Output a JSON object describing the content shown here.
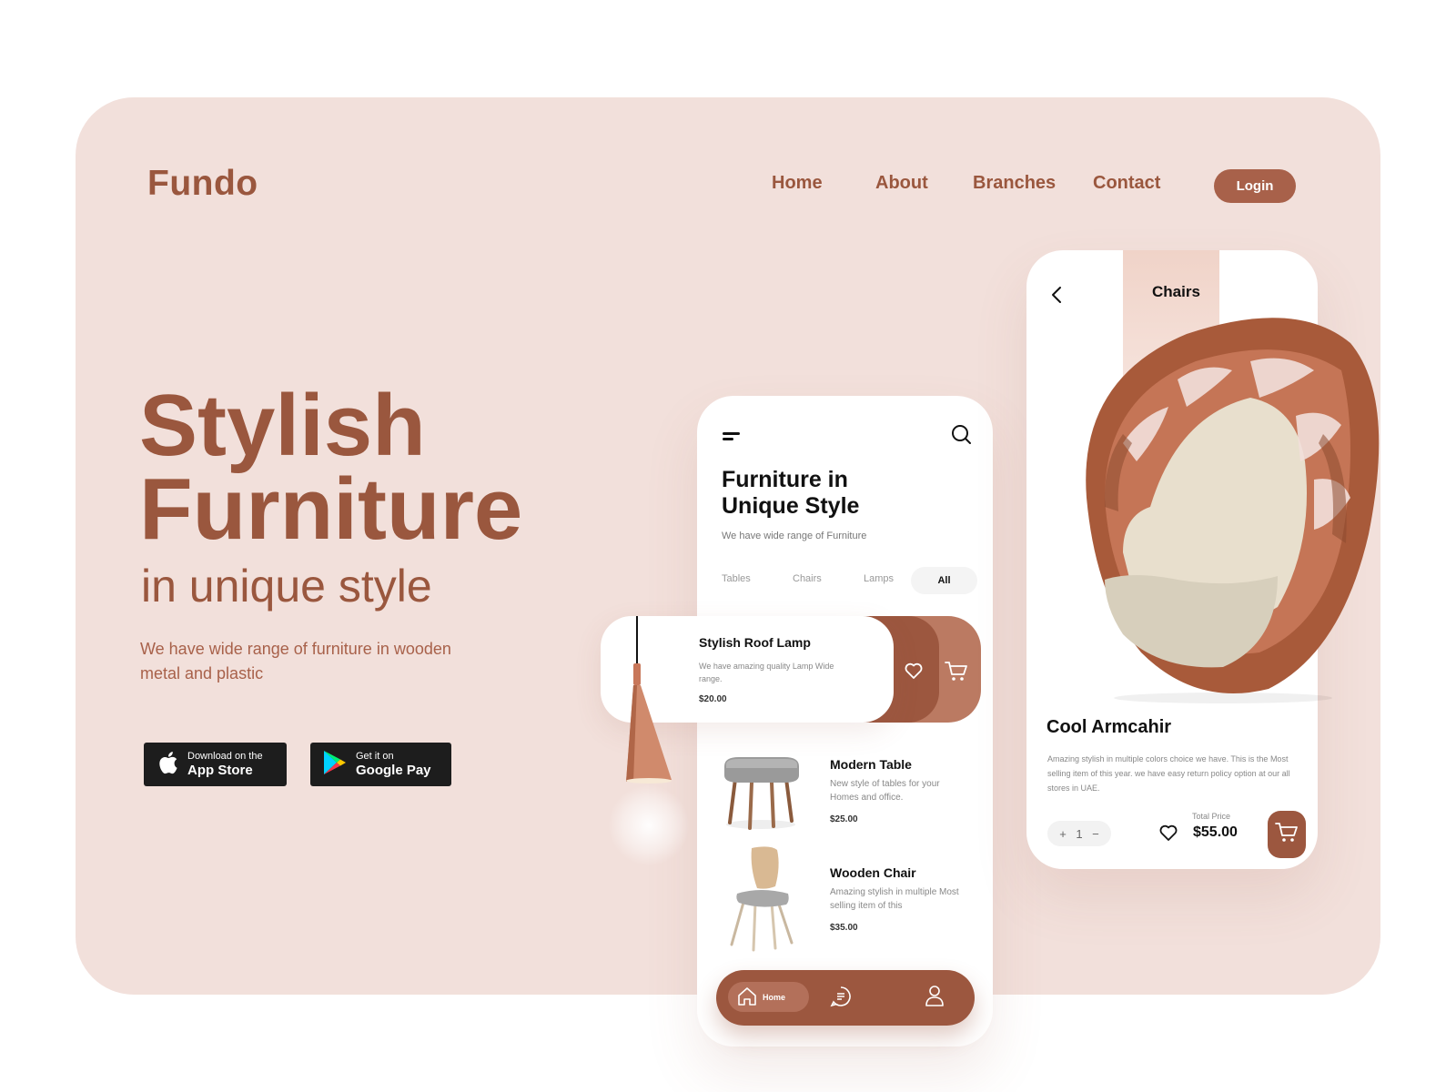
{
  "brand": {
    "name": "Fundo"
  },
  "nav": {
    "items": [
      "Home",
      "About",
      "Branches",
      "Contact"
    ],
    "login": "Login"
  },
  "hero": {
    "line1": "Stylish",
    "line2": "Furniture",
    "line3": "in unique style",
    "description": "We have wide range of furniture in wooden metal and plastic"
  },
  "stores": {
    "apple": {
      "small": "Download on the",
      "big": "App Store"
    },
    "google": {
      "small": "Get it on",
      "big": "Google Pay"
    }
  },
  "mobile_home": {
    "title_line1": "Furniture in",
    "title_line2": "Unique Style",
    "subtitle": "We have wide range of Furniture",
    "categories": [
      "Tables",
      "Chairs",
      "Lamps",
      "All"
    ],
    "active_category": "All",
    "featured": {
      "title": "Stylish Roof Lamp",
      "description": "We have amazing quality Lamp Wide range.",
      "price": "$20.00"
    },
    "products": [
      {
        "title": "Modern Table",
        "description": "New style of  tables for your Homes and office.",
        "price": "$25.00"
      },
      {
        "title": "Wooden Chair",
        "description": "Amazing stylish in multiple Most selling item of this",
        "price": "$35.00"
      }
    ],
    "bottom_nav": {
      "home": "Home"
    }
  },
  "mobile_detail": {
    "title": "Chairs",
    "product_name": "Cool Armcahir",
    "description": "Amazing stylish in multiple colors choice we have. This is the Most selling item of this year. we have easy return policy option at our all stores in UAE.",
    "quantity": "1",
    "plus": "+",
    "minus": "−",
    "total_label": "Total Price",
    "total_price": "$55.00"
  },
  "colors": {
    "brand": "#9a573e",
    "accent": "#9c573f",
    "background": "#f2e0db"
  }
}
